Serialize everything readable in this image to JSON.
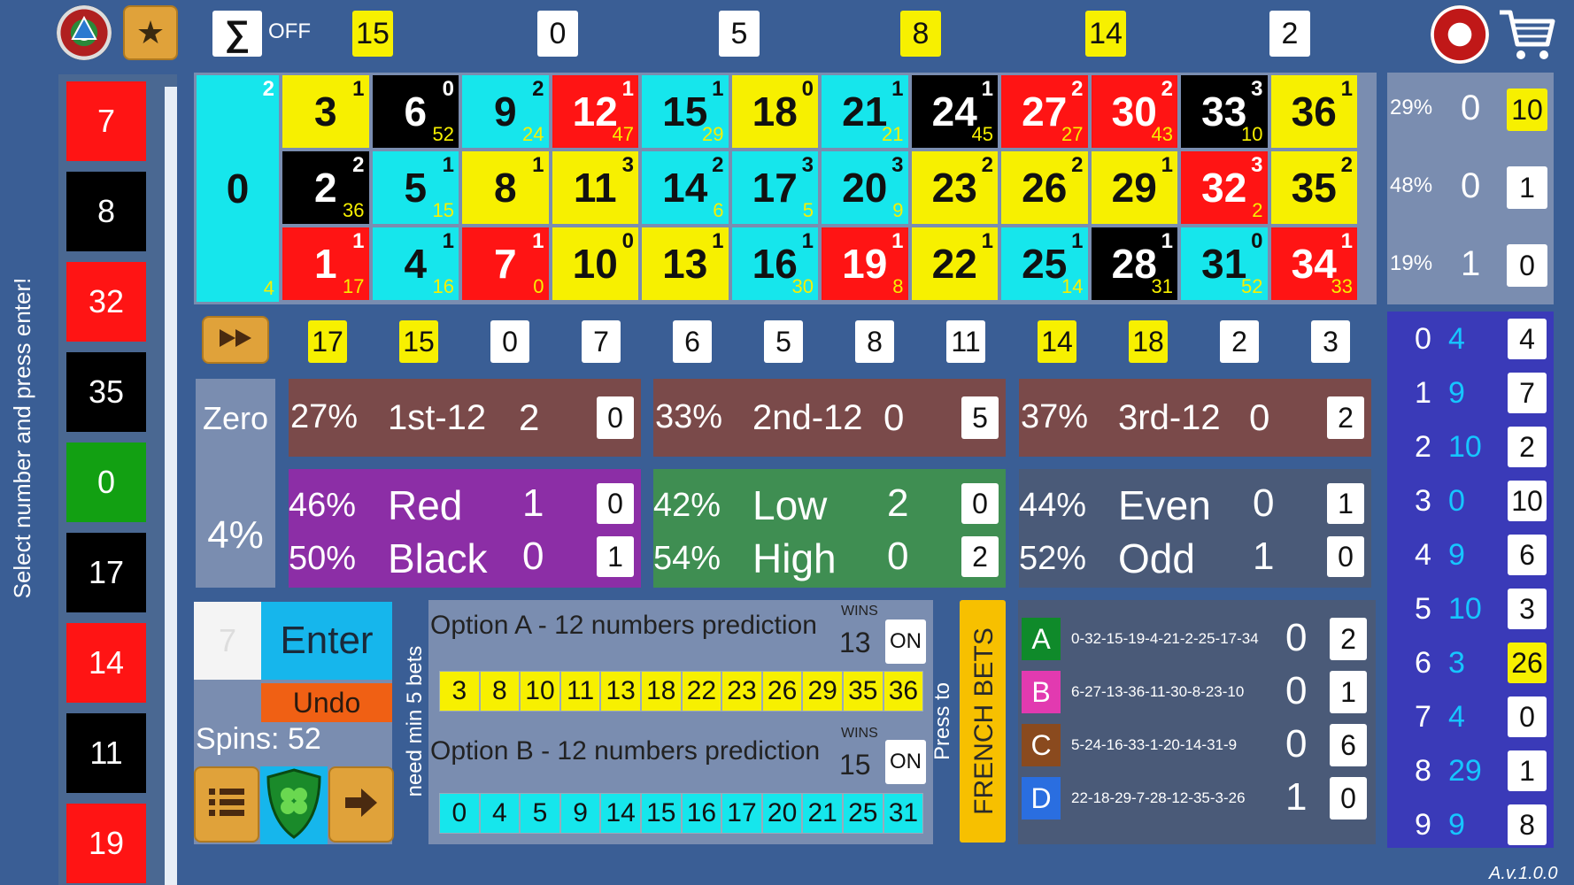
{
  "version": "A.v.1.0.0",
  "sidebar_hint": "Select number and press enter!",
  "sum_toggle": {
    "symbol": "∑",
    "state": "OFF"
  },
  "top_counters": [
    {
      "value": "15",
      "highlight": true
    },
    {
      "value": "0",
      "highlight": false
    },
    {
      "value": "5",
      "highlight": false
    },
    {
      "value": "8",
      "highlight": true
    },
    {
      "value": "14",
      "highlight": true
    },
    {
      "value": "2",
      "highlight": false
    }
  ],
  "history": [
    {
      "n": "7",
      "color": "#ff1414"
    },
    {
      "n": "8",
      "color": "#000000"
    },
    {
      "n": "32",
      "color": "#ff1414"
    },
    {
      "n": "35",
      "color": "#000000"
    },
    {
      "n": "0",
      "color": "#12a012"
    },
    {
      "n": "17",
      "color": "#000000"
    },
    {
      "n": "14",
      "color": "#ff1414"
    },
    {
      "n": "11",
      "color": "#000000"
    },
    {
      "n": "19",
      "color": "#ff1414"
    }
  ],
  "board": {
    "zero": {
      "n": "0",
      "tr": "2",
      "br": "4"
    },
    "cells": [
      [
        {
          "n": "3",
          "tr": "1",
          "br": "",
          "c": "y"
        },
        {
          "n": "6",
          "tr": "0",
          "br": "52",
          "c": "k"
        },
        {
          "n": "9",
          "tr": "2",
          "br": "24",
          "c": "c"
        },
        {
          "n": "12",
          "tr": "1",
          "br": "47",
          "c": "r"
        },
        {
          "n": "15",
          "tr": "1",
          "br": "29",
          "c": "c"
        },
        {
          "n": "18",
          "tr": "0",
          "br": "",
          "c": "y"
        },
        {
          "n": "21",
          "tr": "1",
          "br": "21",
          "c": "c"
        },
        {
          "n": "24",
          "tr": "1",
          "br": "45",
          "c": "k"
        },
        {
          "n": "27",
          "tr": "2",
          "br": "27",
          "c": "r"
        },
        {
          "n": "30",
          "tr": "2",
          "br": "43",
          "c": "r"
        },
        {
          "n": "33",
          "tr": "3",
          "br": "10",
          "c": "k"
        },
        {
          "n": "36",
          "tr": "1",
          "br": "",
          "c": "y"
        }
      ],
      [
        {
          "n": "2",
          "tr": "2",
          "br": "36",
          "c": "k"
        },
        {
          "n": "5",
          "tr": "1",
          "br": "15",
          "c": "c"
        },
        {
          "n": "8",
          "tr": "1",
          "br": "",
          "c": "y"
        },
        {
          "n": "11",
          "tr": "3",
          "br": "",
          "c": "y"
        },
        {
          "n": "14",
          "tr": "2",
          "br": "6",
          "c": "c"
        },
        {
          "n": "17",
          "tr": "3",
          "br": "5",
          "c": "c"
        },
        {
          "n": "20",
          "tr": "3",
          "br": "9",
          "c": "c"
        },
        {
          "n": "23",
          "tr": "2",
          "br": "",
          "c": "y"
        },
        {
          "n": "26",
          "tr": "2",
          "br": "",
          "c": "y"
        },
        {
          "n": "29",
          "tr": "1",
          "br": "",
          "c": "y"
        },
        {
          "n": "32",
          "tr": "3",
          "br": "2",
          "c": "r"
        },
        {
          "n": "35",
          "tr": "2",
          "br": "",
          "c": "y"
        }
      ],
      [
        {
          "n": "1",
          "tr": "1",
          "br": "17",
          "c": "r"
        },
        {
          "n": "4",
          "tr": "1",
          "br": "16",
          "c": "c"
        },
        {
          "n": "7",
          "tr": "1",
          "br": "0",
          "c": "r"
        },
        {
          "n": "10",
          "tr": "0",
          "br": "",
          "c": "y"
        },
        {
          "n": "13",
          "tr": "1",
          "br": "",
          "c": "y"
        },
        {
          "n": "16",
          "tr": "1",
          "br": "30",
          "c": "c"
        },
        {
          "n": "19",
          "tr": "1",
          "br": "8",
          "c": "r"
        },
        {
          "n": "22",
          "tr": "1",
          "br": "",
          "c": "y"
        },
        {
          "n": "25",
          "tr": "1",
          "br": "14",
          "c": "c"
        },
        {
          "n": "28",
          "tr": "1",
          "br": "31",
          "c": "k"
        },
        {
          "n": "31",
          "tr": "0",
          "br": "52",
          "c": "c"
        },
        {
          "n": "34",
          "tr": "1",
          "br": "33",
          "c": "r"
        }
      ]
    ]
  },
  "row_stats": [
    {
      "pct": "29%",
      "count": "0",
      "box": "10",
      "highlight": true
    },
    {
      "pct": "48%",
      "count": "0",
      "box": "1",
      "highlight": false
    },
    {
      "pct": "19%",
      "count": "1",
      "box": "0",
      "highlight": false
    }
  ],
  "column_counters": [
    {
      "v": "17",
      "h": true
    },
    {
      "v": "15",
      "h": true
    },
    {
      "v": "0",
      "h": false
    },
    {
      "v": "7",
      "h": false
    },
    {
      "v": "6",
      "h": false
    },
    {
      "v": "5",
      "h": false
    },
    {
      "v": "8",
      "h": false
    },
    {
      "v": "11",
      "h": false
    },
    {
      "v": "14",
      "h": true
    },
    {
      "v": "18",
      "h": true
    },
    {
      "v": "2",
      "h": false
    },
    {
      "v": "3",
      "h": false
    }
  ],
  "zero_panel": {
    "label": "Zero",
    "pct": "4%"
  },
  "dozens": [
    {
      "pct": "27%",
      "label": "1st-12",
      "count": "2",
      "box": "0"
    },
    {
      "pct": "33%",
      "label": "2nd-12",
      "count": "0",
      "box": "5"
    },
    {
      "pct": "37%",
      "label": "3rd-12",
      "count": "0",
      "box": "2"
    }
  ],
  "even_chances": [
    {
      "bg": "#8c2ea6",
      "items": [
        {
          "pct": "46%",
          "label": "Red",
          "count": "1",
          "box": "0"
        },
        {
          "pct": "50%",
          "label": "Black",
          "count": "0",
          "box": "1"
        }
      ]
    },
    {
      "bg": "#3f8e52",
      "items": [
        {
          "pct": "42%",
          "label": "Low",
          "count": "2",
          "box": "0"
        },
        {
          "pct": "54%",
          "label": "High",
          "count": "0",
          "box": "2"
        }
      ]
    },
    {
      "bg": "#4a5a78",
      "items": [
        {
          "pct": "44%",
          "label": "Even",
          "count": "0",
          "box": "1"
        },
        {
          "pct": "52%",
          "label": "Odd",
          "count": "1",
          "box": "0"
        }
      ]
    }
  ],
  "input": {
    "value": "7",
    "enter": "Enter",
    "undo": "Undo",
    "spins": "Spins: 52"
  },
  "need_label": "need min 5 bets",
  "option_a": {
    "title": "Option A - 12 numbers prediction",
    "wins_label": "WINS",
    "wins": "13",
    "toggle": "ON",
    "numbers": [
      "3",
      "8",
      "10",
      "11",
      "13",
      "18",
      "22",
      "23",
      "26",
      "29",
      "35",
      "36"
    ]
  },
  "option_b": {
    "title": "Option B - 12 numbers prediction",
    "wins_label": "WINS",
    "wins": "15",
    "toggle": "ON",
    "numbers": [
      "0",
      "4",
      "5",
      "9",
      "14",
      "15",
      "16",
      "17",
      "20",
      "21",
      "25",
      "31"
    ]
  },
  "french_bets": {
    "press": "Press to",
    "label": "FRENCH BETS"
  },
  "groups": [
    {
      "letter": "A",
      "color": "#0f8a2a",
      "seq": "0-32-15-19-4-21-2-25-17-34",
      "count": "0",
      "box": "2"
    },
    {
      "letter": "B",
      "color": "#e23ab0",
      "seq": "6-27-13-36-11-30-8-23-10",
      "count": "0",
      "box": "1"
    },
    {
      "letter": "C",
      "color": "#8a4a1e",
      "seq": "5-24-16-33-1-20-14-31-9",
      "count": "0",
      "box": "6"
    },
    {
      "letter": "D",
      "color": "#2a6ee0",
      "seq": "22-18-29-7-28-12-35-3-26",
      "count": "1",
      "box": "0"
    }
  ],
  "digits": [
    {
      "d": "0",
      "v": "4",
      "box": "4",
      "h": false
    },
    {
      "d": "1",
      "v": "9",
      "box": "7",
      "h": false
    },
    {
      "d": "2",
      "v": "10",
      "box": "2",
      "h": false
    },
    {
      "d": "3",
      "v": "0",
      "box": "10",
      "h": false
    },
    {
      "d": "4",
      "v": "9",
      "box": "6",
      "h": false
    },
    {
      "d": "5",
      "v": "10",
      "box": "3",
      "h": false
    },
    {
      "d": "6",
      "v": "3",
      "box": "26",
      "h": true
    },
    {
      "d": "7",
      "v": "4",
      "box": "0",
      "h": false
    },
    {
      "d": "8",
      "v": "29",
      "box": "1",
      "h": false
    },
    {
      "d": "9",
      "v": "9",
      "box": "8",
      "h": false
    }
  ]
}
